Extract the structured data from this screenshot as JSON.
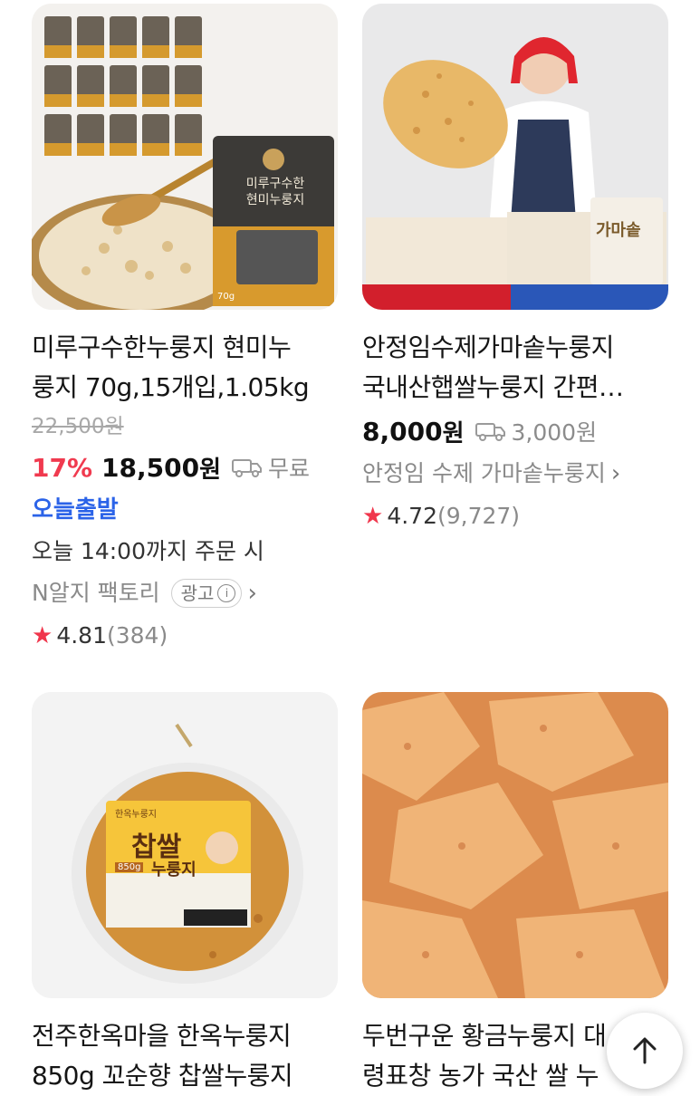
{
  "products": [
    {
      "title_line1": "미루구수한누룽지 현미누",
      "title_line2": "룽지 70g,15개입,1.05kg",
      "original_price": "22,500원",
      "discount": "17%",
      "price": "18,500",
      "currency": "원",
      "shipping": "무료",
      "delivery_badge": "오늘출발",
      "delivery_cutoff": "오늘 14:00까지 주문 시",
      "seller": "N알지 팩토리",
      "ad_label": "광고",
      "rating": "4.81",
      "review_count": "(384)",
      "image_pkg_label_1": "미루구수한",
      "image_pkg_label_2": "현미누룽지",
      "image_pkg_weight": "70g"
    },
    {
      "title_line1": "안정임수제가마솥누룽지",
      "title_line2": "국내산햅쌀누룽지 간편…",
      "price": "8,000",
      "currency": "원",
      "shipping": "3,000원",
      "seller": "안정임 수제 가마솥누룽지",
      "rating": "4.72",
      "review_count": "(9,727)",
      "image_pkg_label": "가마솥"
    },
    {
      "title_line1": "전주한옥마을 한옥누룽지",
      "title_line2": "850g 꼬순향 찹쌀누룽지",
      "image_pkg_brand": "한옥누룽지",
      "image_pkg_label_1": "찹쌀",
      "image_pkg_label_2": "누룽지",
      "image_pkg_weight": "850g"
    },
    {
      "title_line1": "두번구운 황금누룽지 대",
      "title_line2": "령표창 농가 국산 쌀 누"
    }
  ],
  "icons": {
    "shipping": "truck-icon",
    "rating": "star-icon",
    "scroll_top": "arrow-up-icon"
  },
  "colors": {
    "discount": "#f03a4f",
    "today_shipping": "#2b63e8",
    "star": "#f0364c"
  }
}
